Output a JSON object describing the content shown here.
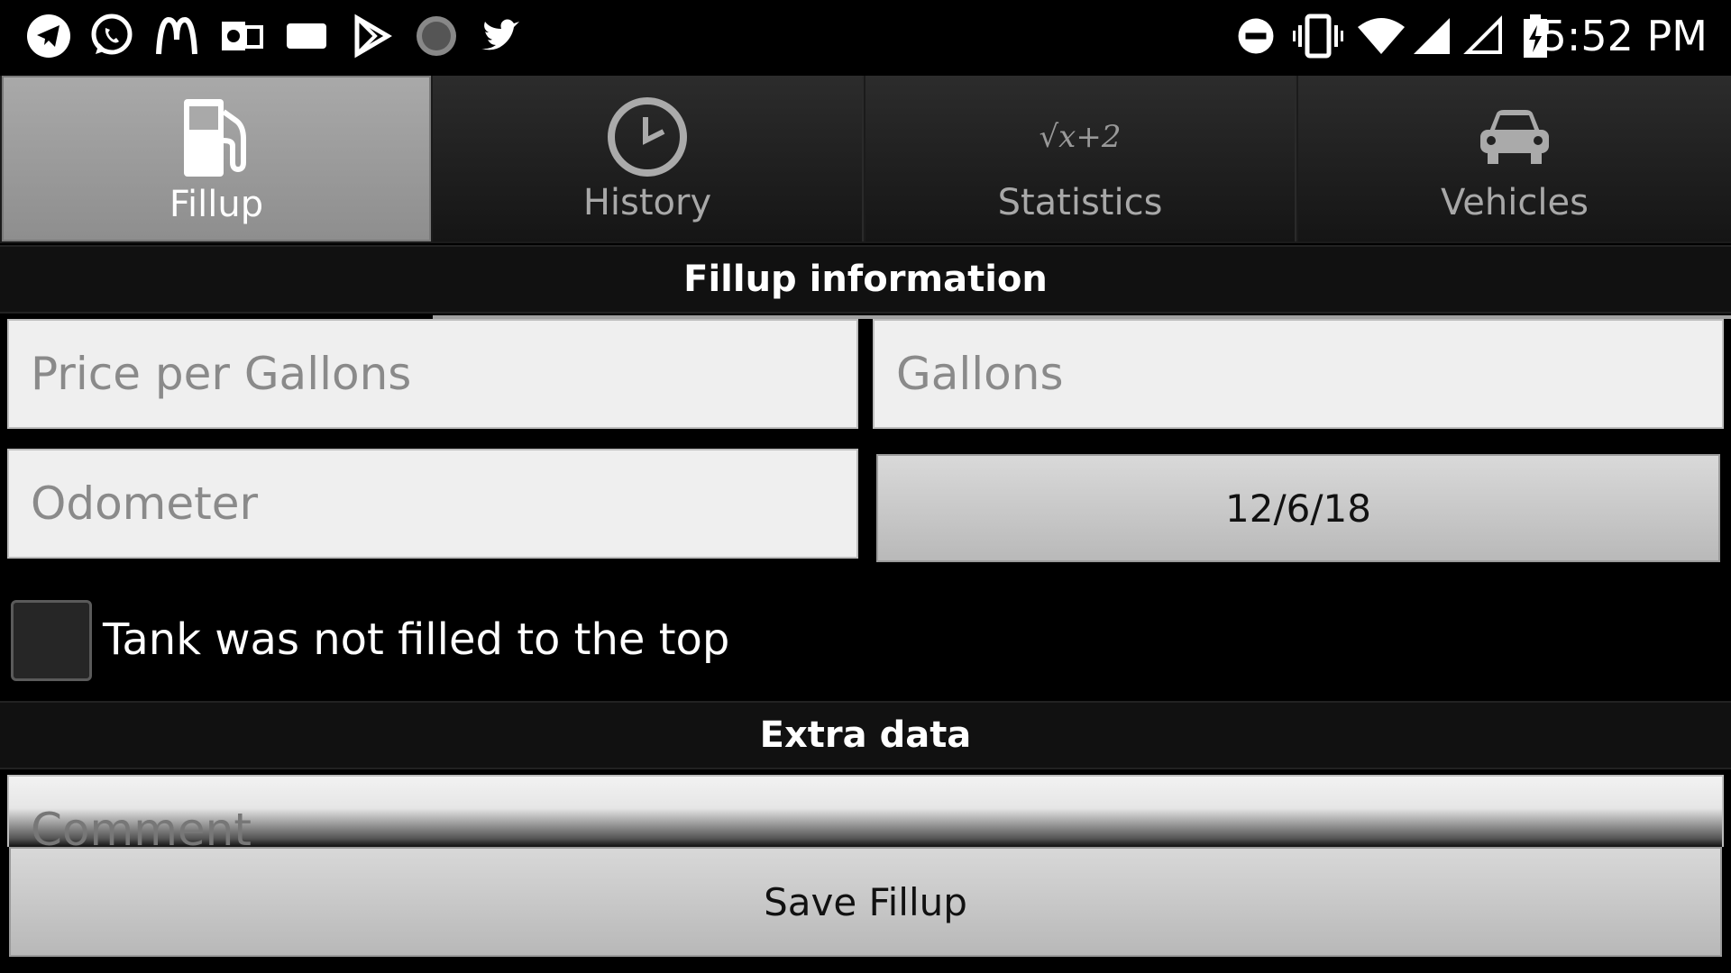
{
  "statusbar": {
    "time": "5:52 PM",
    "left_icons": [
      "telegram-icon",
      "whatsapp-icon",
      "mcdonalds-icon",
      "outlook-icon",
      "message-icon",
      "play-store-icon",
      "circle-app-icon",
      "twitter-icon"
    ],
    "right_icons": [
      "do-not-disturb-icon",
      "vibrate-icon",
      "wifi-icon",
      "signal-icon",
      "signal-empty-icon",
      "battery-charging-icon"
    ]
  },
  "tabs": [
    {
      "label": "Fillup",
      "icon": "fuel-pump-icon",
      "active": true
    },
    {
      "label": "History",
      "icon": "clock-icon",
      "active": false
    },
    {
      "label": "Statistics",
      "icon": "sqrt-formula-icon",
      "active": false,
      "icon_text": "√x+2"
    },
    {
      "label": "Vehicles",
      "icon": "car-icon",
      "active": false
    }
  ],
  "sections": {
    "fillup_info": "Fillup information",
    "extra_data": "Extra data"
  },
  "form": {
    "price_placeholder": "Price per Gallons",
    "gallons_placeholder": "Gallons",
    "odometer_placeholder": "Odometer",
    "date_value": "12/6/18",
    "tank_checkbox_label": "Tank was not filled to the top",
    "tank_checked": false,
    "comment_placeholder": "Comment",
    "save_label": "Save Fillup"
  },
  "colors": {
    "background": "#000000",
    "active_tab": "#9c9c9c",
    "field_bg": "#efefef"
  }
}
